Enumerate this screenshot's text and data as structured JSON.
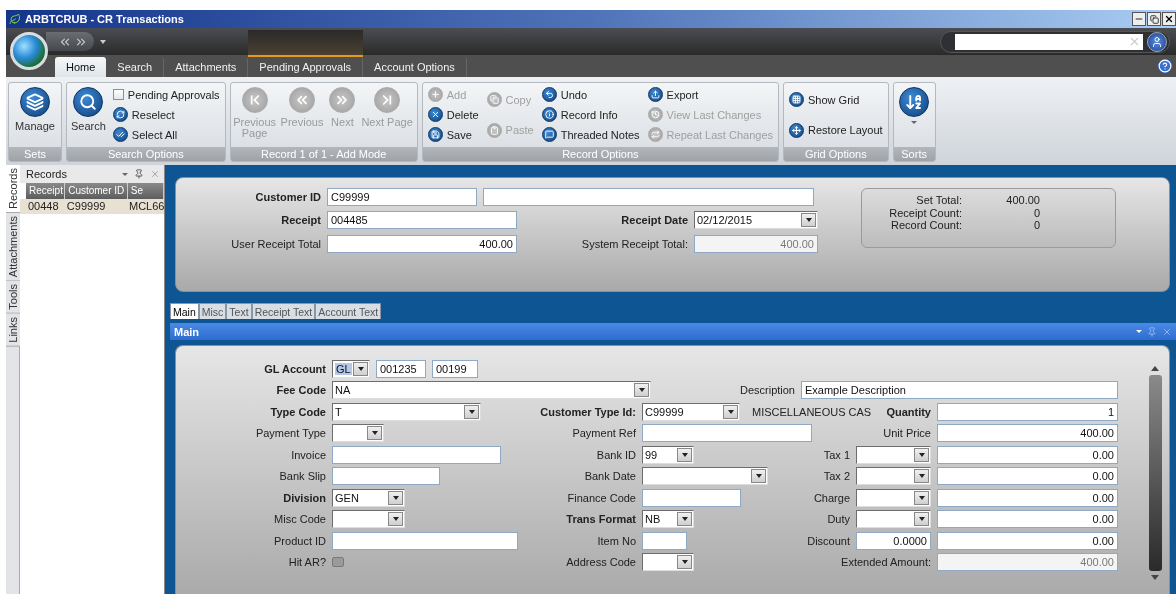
{
  "window": {
    "title": "ARBTCRUB - CR Transactions"
  },
  "ribbon_tabs": [
    {
      "label": "Home",
      "selected": true,
      "contextual": false
    },
    {
      "label": "Search",
      "selected": false,
      "contextual": false
    },
    {
      "label": "Attachments",
      "selected": false,
      "contextual": false
    },
    {
      "label": "Pending Approvals",
      "selected": false,
      "contextual": true
    },
    {
      "label": "Account Options",
      "selected": false,
      "contextual": false
    }
  ],
  "ribbon_groups": [
    {
      "title": "Sets",
      "items": [
        {
          "kind": "large",
          "label": "Manage",
          "disabled": false
        }
      ]
    },
    {
      "title": "Search Options",
      "items": [
        {
          "kind": "large",
          "label": "Search",
          "disabled": false
        },
        {
          "kind": "stack",
          "items": [
            {
              "kind": "check",
              "label": "Pending Approvals",
              "checked": false
            },
            {
              "kind": "small",
              "label": "Reselect",
              "disabled": false
            },
            {
              "kind": "small",
              "label": "Select All",
              "disabled": false
            }
          ]
        }
      ]
    },
    {
      "title": "Record 1 of 1 - Add Mode",
      "items": [
        {
          "kind": "large",
          "label": "Previous Page",
          "disabled": true
        },
        {
          "kind": "large",
          "label": "Previous",
          "disabled": true
        },
        {
          "kind": "large",
          "label": "Next",
          "disabled": true
        },
        {
          "kind": "large",
          "label": "Next Page",
          "disabled": true
        }
      ]
    },
    {
      "title": "Record Options",
      "items": [
        {
          "kind": "stack",
          "items": [
            {
              "kind": "small",
              "label": "Add",
              "disabled": true
            },
            {
              "kind": "small",
              "label": "Delete",
              "disabled": false
            },
            {
              "kind": "small",
              "label": "Save",
              "disabled": false
            }
          ]
        },
        {
          "kind": "stack",
          "items": [
            {
              "kind": "small",
              "label": "Copy",
              "disabled": true
            },
            {
              "kind": "small",
              "label": "Paste",
              "disabled": true
            }
          ]
        },
        {
          "kind": "stack",
          "items": [
            {
              "kind": "small",
              "label": "Undo",
              "disabled": false
            },
            {
              "kind": "small",
              "label": "Record Info",
              "disabled": false
            },
            {
              "kind": "small",
              "label": "Threaded Notes",
              "disabled": false
            }
          ]
        },
        {
          "kind": "stack",
          "items": [
            {
              "kind": "small",
              "label": "Export",
              "disabled": false
            },
            {
              "kind": "small",
              "label": "View Last Changes",
              "disabled": true
            },
            {
              "kind": "small",
              "label": "Repeat Last Changes",
              "disabled": true
            }
          ]
        }
      ]
    },
    {
      "title": "Grid Options",
      "items": [
        {
          "kind": "stack",
          "items": [
            {
              "kind": "small",
              "label": "Show Grid",
              "disabled": false
            },
            {
              "kind": "small",
              "label": "Restore Layout",
              "disabled": false
            }
          ]
        }
      ]
    },
    {
      "title": "Sorts",
      "items": [
        {
          "kind": "menu",
          "disabled": false
        }
      ]
    }
  ],
  "side_tabs": [
    {
      "label": "Records",
      "selected": true
    },
    {
      "label": "Attachments",
      "selected": false
    },
    {
      "label": "Tools",
      "selected": false
    },
    {
      "label": "Links",
      "selected": false
    }
  ],
  "records_panel": {
    "title": "Records",
    "columns": [
      "Receipt",
      "Customer ID",
      "Se"
    ],
    "rows": [
      {
        "cells": [
          "00448",
          "C99999",
          "MCL66"
        ],
        "selected": true
      }
    ]
  },
  "header": {
    "rows": [
      {
        "left": {
          "label": "Customer ID",
          "required": true,
          "fields": [
            {
              "kind": "text",
              "value": "C99999"
            },
            {
              "kind": "text"
            }
          ]
        }
      },
      {
        "left": {
          "label": "Receipt",
          "required": true,
          "fields": [
            {
              "kind": "text",
              "value": "004485"
            }
          ]
        },
        "middle": {
          "label": "Receipt Date",
          "required": true,
          "fields": [
            {
              "kind": "combo",
              "value": "02/12/2015"
            }
          ]
        }
      },
      {
        "left": {
          "label": "User Receipt Total",
          "fields": [
            {
              "kind": "text",
              "value": "400.00"
            }
          ]
        },
        "middle": {
          "label": "System Receipt Total:",
          "fields": [
            {
              "kind": "text",
              "value": "400.00",
              "disabled": true
            }
          ]
        }
      }
    ],
    "summary": [
      {
        "label": "Set Total:",
        "value": "400.00"
      },
      {
        "label": "Receipt Count:",
        "value": "0"
      },
      {
        "label": "Record Count:",
        "value": "0"
      }
    ]
  },
  "form_tabs": [
    {
      "label": "Main",
      "selected": true
    },
    {
      "label": "Misc",
      "selected": false
    },
    {
      "label": "Text",
      "selected": false
    },
    {
      "label": "Receipt Text",
      "selected": false
    },
    {
      "label": "Account Text",
      "selected": false
    }
  ],
  "pane": {
    "title": "Main"
  },
  "form": {
    "rows": [
      {
        "left": {
          "label": "GL Account",
          "required": true,
          "fields": [
            {
              "kind": "combo",
              "value": "GL",
              "highlighted": true
            },
            {
              "kind": "text",
              "value": "001235"
            },
            {
              "kind": "text",
              "value": "00199"
            }
          ]
        }
      },
      {
        "left": {
          "label": "Fee Code",
          "required": true,
          "fields": [
            {
              "kind": "combo",
              "value": "NA"
            }
          ]
        },
        "right": {
          "label": "Description",
          "fields": [
            {
              "kind": "text",
              "value": "Example Description"
            }
          ]
        }
      },
      {
        "left": {
          "label": "Type Code",
          "required": true,
          "fields": [
            {
              "kind": "combo",
              "value": "T"
            }
          ]
        },
        "middle": {
          "label": "Customer Type Id:",
          "required": true,
          "fields": [
            {
              "kind": "combo",
              "value": "C99999"
            },
            {
              "kind": "note",
              "value": "MISCELLANEOUS CAS"
            }
          ]
        },
        "right": {
          "label": "Quantity",
          "required": true,
          "fields": [
            {
              "kind": "text",
              "value": "1"
            }
          ]
        }
      },
      {
        "left": {
          "label": "Payment Type",
          "fields": [
            {
              "kind": "combo"
            }
          ]
        },
        "middle": {
          "label": "Payment Ref",
          "fields": [
            {
              "kind": "text"
            }
          ]
        },
        "right": {
          "label": "Unit Price",
          "fields": [
            {
              "kind": "text",
              "value": "400.00"
            }
          ]
        }
      },
      {
        "left": {
          "label": "Invoice",
          "fields": [
            {
              "kind": "text"
            }
          ]
        },
        "middle": {
          "label": "Bank ID",
          "fields": [
            {
              "kind": "combo",
              "value": "99"
            }
          ]
        },
        "right": {
          "label": "Tax 1",
          "fields": [
            {
              "kind": "combo"
            },
            {
              "kind": "text",
              "value": "0.00"
            }
          ]
        }
      },
      {
        "left": {
          "label": "Bank Slip",
          "fields": [
            {
              "kind": "text"
            }
          ]
        },
        "middle": {
          "label": "Bank Date",
          "fields": [
            {
              "kind": "combo"
            }
          ]
        },
        "right": {
          "label": "Tax 2",
          "fields": [
            {
              "kind": "combo"
            },
            {
              "kind": "text",
              "value": "0.00"
            }
          ]
        }
      },
      {
        "left": {
          "label": "Division",
          "required": true,
          "fields": [
            {
              "kind": "combo",
              "value": "GEN"
            }
          ]
        },
        "middle": {
          "label": "Finance Code",
          "fields": [
            {
              "kind": "text"
            }
          ]
        },
        "right": {
          "label": "Charge",
          "fields": [
            {
              "kind": "combo"
            },
            {
              "kind": "text",
              "value": "0.00"
            }
          ]
        }
      },
      {
        "left": {
          "label": "Misc Code",
          "fields": [
            {
              "kind": "combo"
            }
          ]
        },
        "middle": {
          "label": "Trans Format",
          "required": true,
          "fields": [
            {
              "kind": "combo",
              "value": "NB"
            }
          ]
        },
        "right": {
          "label": "Duty",
          "fields": [
            {
              "kind": "combo"
            },
            {
              "kind": "text",
              "value": "0.00"
            }
          ]
        }
      },
      {
        "left": {
          "label": "Product ID",
          "fields": [
            {
              "kind": "text"
            }
          ]
        },
        "middle": {
          "label": "Item No",
          "fields": [
            {
              "kind": "text"
            }
          ]
        },
        "right": {
          "label": "Discount",
          "fields": [
            {
              "kind": "text",
              "value": "0.0000"
            },
            {
              "kind": "text",
              "value": "0.00"
            }
          ]
        }
      },
      {
        "left": {
          "label": "Hit AR?",
          "fields": [
            {
              "kind": "check",
              "checked": false,
              "disabled": true
            }
          ]
        },
        "middle": {
          "label": "Address Code",
          "fields": [
            {
              "kind": "combo"
            }
          ]
        },
        "right": {
          "label": "Extended Amount:",
          "fields": [
            {
              "kind": "text",
              "value": "400.00",
              "disabled": true
            }
          ]
        }
      }
    ]
  }
}
